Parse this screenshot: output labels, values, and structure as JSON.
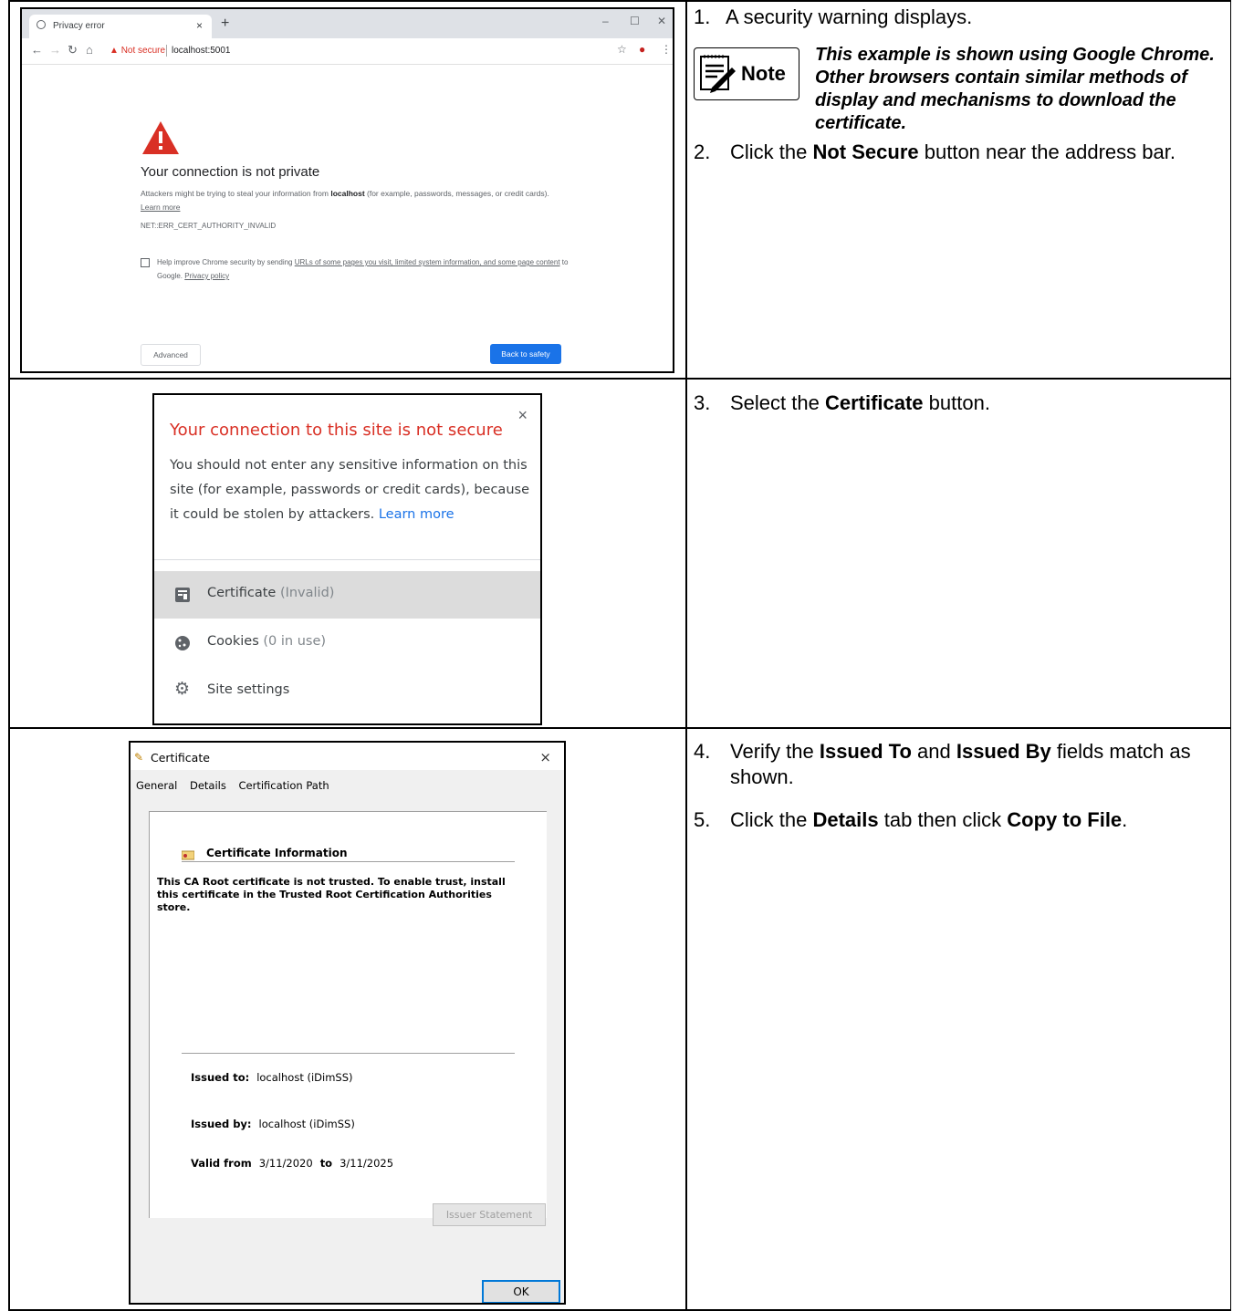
{
  "steps": {
    "s1": {
      "num": "1.",
      "text": "A security warning displays."
    },
    "note": {
      "label": "Note",
      "text": "This example is shown using Google Chrome. Other browsers contain similar methods of display and mechanisms to download the certificate."
    },
    "s2": {
      "num": "2.",
      "pre": "Click the ",
      "bold": "Not Secure",
      "post": " button near the address bar."
    },
    "s3": {
      "num": "3.",
      "pre": "Select the ",
      "bold": "Certificate",
      "post": " button."
    },
    "s4": {
      "num": "4.",
      "pre": "Verify the ",
      "bold1": "Issued To",
      "mid": " and ",
      "bold2": "Issued By",
      "post1": " fields match as",
      "post2": "shown."
    },
    "s5": {
      "num": "5.",
      "pre": "Click the ",
      "bold1": "Details",
      "mid": " tab then click ",
      "bold2": "Copy to File",
      "post": "."
    }
  },
  "chrome": {
    "tab_title": "Privacy error",
    "tab_close": "×",
    "new_tab": "+",
    "not_secure": "Not secure",
    "url": "localhost:5001",
    "heading": "Your connection is not private",
    "body_pre": "Attackers might be trying to steal your information from ",
    "body_host": "localhost",
    "body_post": " (for example, passwords, messages, or credit cards).",
    "learn_more": "Learn more",
    "error_code": "NET::ERR_CERT_AUTHORITY_INVALID",
    "check_pre": "Help improve Chrome security by sending ",
    "check_link": "URLs of some pages you visit, limited system information, and some page content",
    "check_mid": " to Google. ",
    "check_privacy": "Privacy policy",
    "advanced": "Advanced",
    "back": "Back to safety"
  },
  "popup": {
    "title": "Your connection to this site is not secure",
    "close": "×",
    "body": "You should not enter any sensitive information on this site (for example, passwords or credit cards), because it could be stolen by attackers.",
    "learn_more": "Learn more",
    "cert_label": "Certificate",
    "cert_status": "(Invalid)",
    "cookies_label": "Cookies",
    "cookies_status": "(0 in use)",
    "site_settings": "Site settings"
  },
  "cert": {
    "window_title": "Certificate",
    "close": "×",
    "tabs": [
      "General",
      "Details",
      "Certification Path"
    ],
    "info_header": "Certificate Information",
    "warning": "This CA Root certificate is not trusted. To enable trust, install this certificate in the Trusted Root Certification Authorities store.",
    "issued_to_label": "Issued to:",
    "issued_to": "localhost (iDimSS)",
    "issued_by_label": "Issued by:",
    "issued_by": "localhost (iDimSS)",
    "valid_from_label": "Valid from",
    "valid_from": "3/11/2020",
    "valid_to_label": "to",
    "valid_to": "3/11/2025",
    "issuer_statement": "Issuer Statement",
    "ok": "OK"
  }
}
